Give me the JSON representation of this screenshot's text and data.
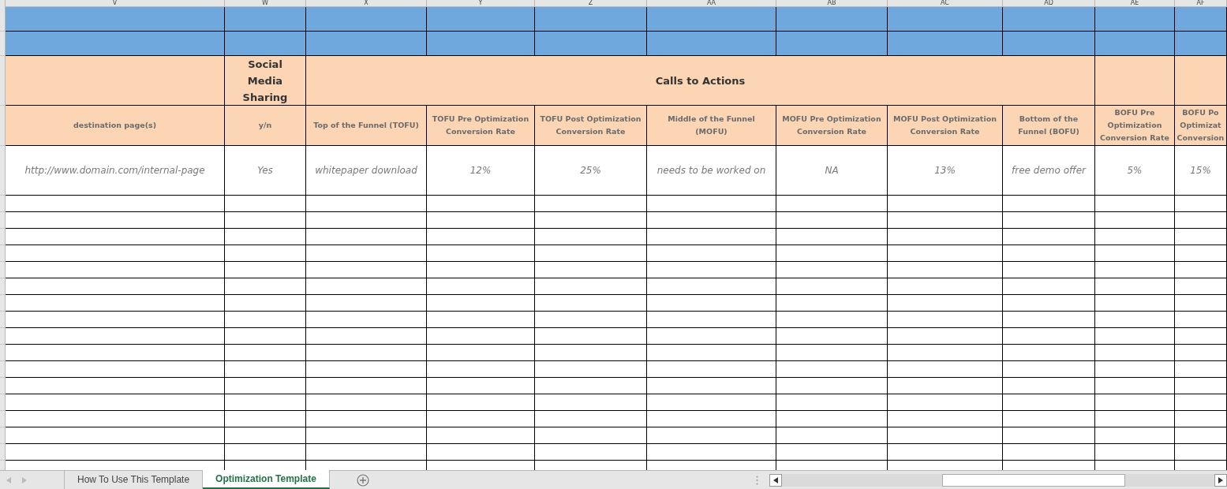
{
  "column_headers": [
    "V",
    "W",
    "X",
    "Y",
    "Z",
    "AA",
    "AB",
    "AC",
    "AD",
    "AE",
    "AF"
  ],
  "group_headers": {
    "social": "Social Media Sharing",
    "calls": "Calls to Actions"
  },
  "columns": [
    "destination page(s)",
    "y/n",
    "Top of the Funnel (TOFU)",
    "TOFU Pre Optimization Conversion Rate",
    "TOFU Post Optimization Conversion Rate",
    "Middle of the Funnel (MOFU)",
    "MOFU Pre Optimization Conversion Rate",
    "MOFU Post Optimization Conversion Rate",
    "Bottom of the Funnel (BOFU)",
    "BOFU Pre Optimization Conversion Rate",
    "BOFU Po Optimizat Conversion"
  ],
  "rows": [
    [
      "http://www.domain.com/internal-page",
      "Yes",
      "whitepaper download",
      "12%",
      "25%",
      "needs to be worked on",
      "NA",
      "13%",
      "free demo offer",
      "5%",
      "15%"
    ]
  ],
  "sheet_tabs": [
    {
      "label": "How To Use This Template",
      "selected": false
    },
    {
      "label": "Optimization Template",
      "selected": true
    }
  ]
}
